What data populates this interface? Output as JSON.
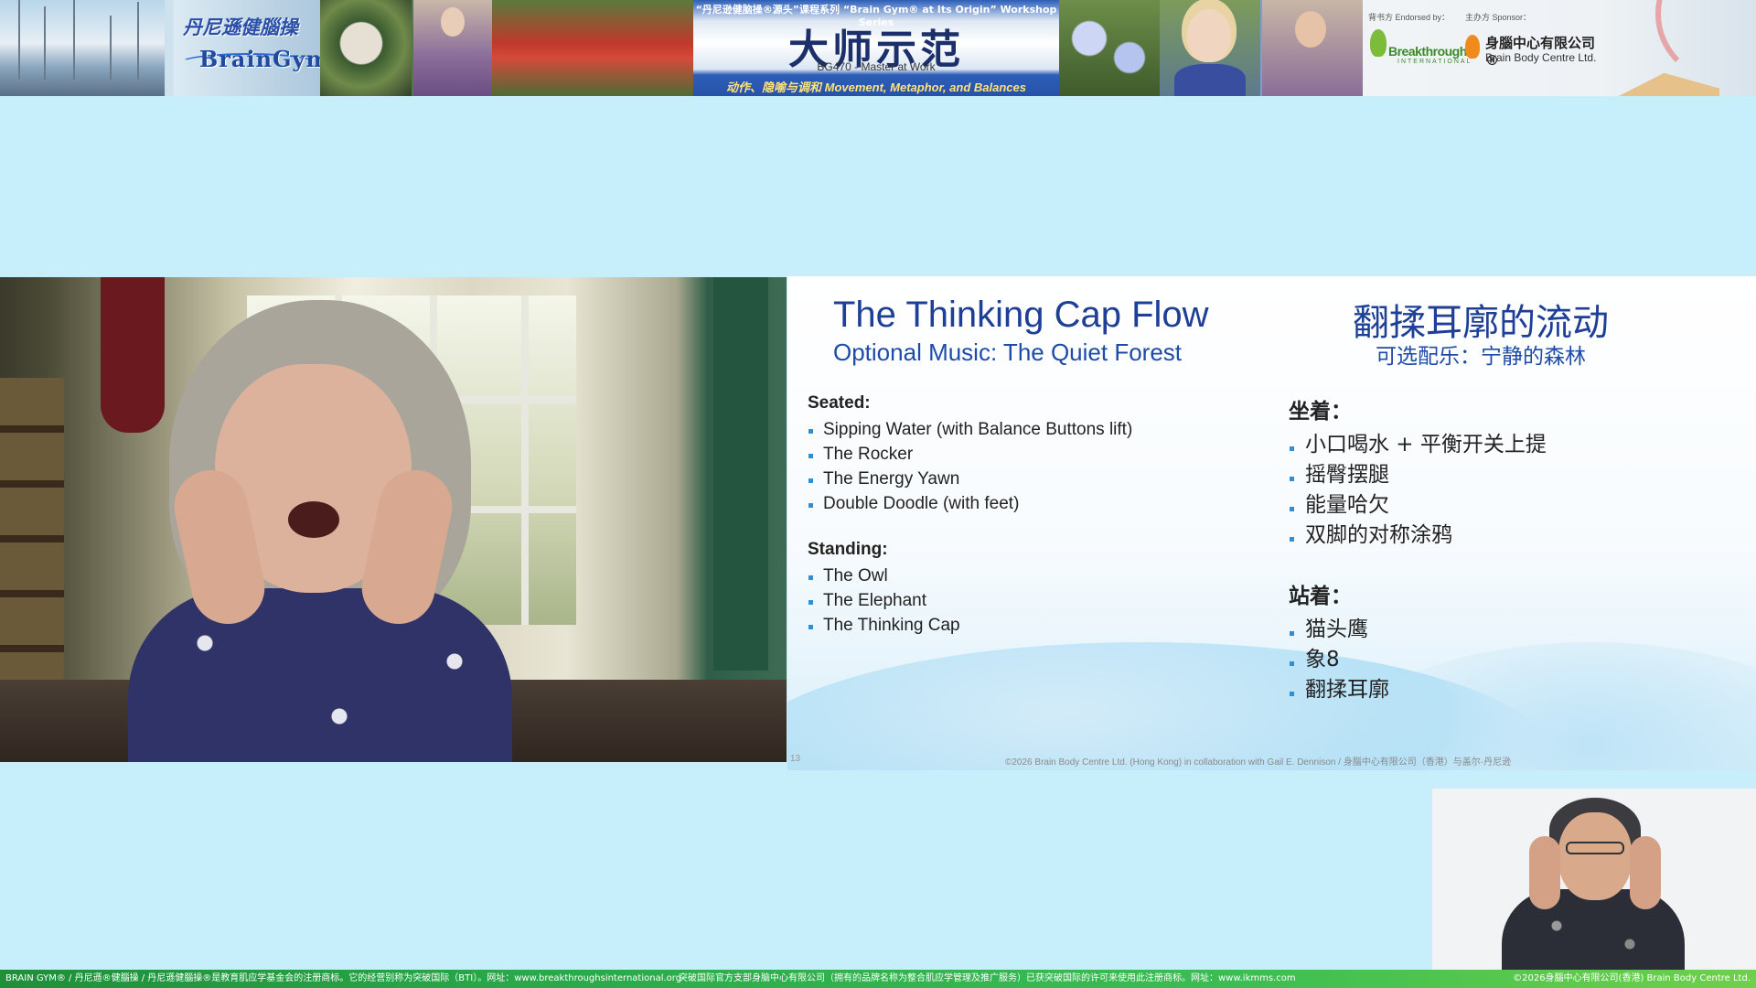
{
  "banner": {
    "logo_cn": "丹尼遜健腦操",
    "logo_en": "BrainGym",
    "series_label": "“丹尼逊健脑操®源头”课程系列 “Brain Gym® at Its Origin” Workshop Series",
    "main_title": "大师示范",
    "course_code": "BG470 - Master at Work",
    "subtitle": "动作、隐喻与调和 Movement, Metaphor, and Balances",
    "endorsed_label": "背书方 Endorsed by：",
    "sponsor_label": "主办方 Sponsor：",
    "bti_name": "Breakthroughs",
    "bti_sub": "INTERNATIONAL",
    "bbc_cn": "身腦中心有限公司 ®",
    "bbc_en": "Brain Body Centre Ltd."
  },
  "slide": {
    "title_en": "The Thinking Cap Flow",
    "music_en": "Optional Music: The Quiet Forest",
    "title_cn": "翻揉耳廓的流动",
    "music_cn": "可选配乐：宁静的森林",
    "en": {
      "seated_label": "Seated:",
      "seated": [
        "Sipping Water (with Balance Buttons lift)",
        "The Rocker",
        "The Energy Yawn",
        "Double Doodle (with feet)"
      ],
      "standing_label": "Standing:",
      "standing": [
        "The Owl",
        "The Elephant",
        "The Thinking Cap"
      ]
    },
    "cn": {
      "seated_label": "坐着：",
      "seated": [
        "小口喝水 + 平衡开关上提",
        "摇臀摆腿",
        "能量哈欠",
        "双脚的对称涂鸦"
      ],
      "standing_label": "站着：",
      "standing": [
        "猫头鹰",
        "象8",
        "翻揉耳廓"
      ]
    },
    "page_number": "13",
    "copyright": "©2026 Brain Body Centre Ltd. (Hong Kong) in collaboration with Gail E. Dennison / 身腦中心有限公司（香港）与盖尔·丹尼逊"
  },
  "footer": {
    "left": "BRAIN GYM® / 丹尼遜®健腦操 / 丹尼遜健腦操®是教育肌应学基金会的注册商标。它的经营别称为突破国际（BTI）。网址：www.breakthroughsinternational.org",
    "middle": "突破国际官方支部身脑中心有限公司（拥有的品牌名称为整合肌应学管理及推广服务）已获突破国际的许可来使用此注册商标。网址：www.ikmms.com",
    "right": "©2026身腦中心有限公司(香港) Brain Body Centre Ltd."
  },
  "colors": {
    "background": "#c6eefb",
    "slide_title": "#1d3f95",
    "bullet": "#2f8fd2",
    "footer": "#2aa84a"
  }
}
